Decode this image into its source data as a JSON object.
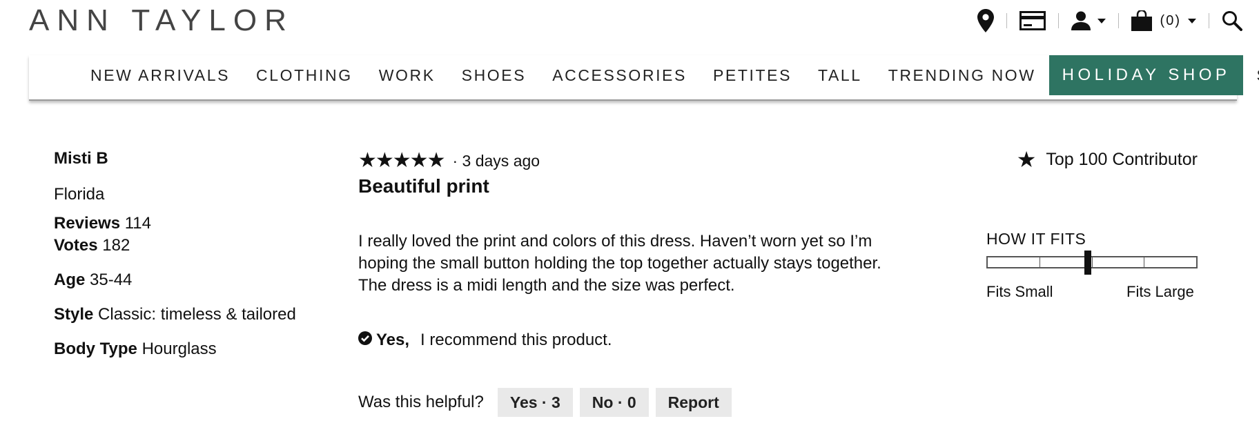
{
  "brand": {
    "logo": "ANN TAYLOR"
  },
  "utility": {
    "icons": [
      "location-pin-icon",
      "credit-card-icon",
      "account-icon",
      "shopping-bag-icon",
      "search-icon"
    ],
    "bag_count": "(0)"
  },
  "nav": {
    "items": [
      {
        "label": "NEW ARRIVALS"
      },
      {
        "label": "CLOTHING"
      },
      {
        "label": "WORK"
      },
      {
        "label": "SHOES"
      },
      {
        "label": "ACCESSORIES"
      },
      {
        "label": "PETITES"
      },
      {
        "label": "TALL"
      },
      {
        "label": "TRENDING NOW"
      },
      {
        "label": "HOLIDAY SHOP",
        "highlight": true
      },
      {
        "label": "SALE"
      }
    ],
    "highlight_color": "#2e7462"
  },
  "reviewer": {
    "name": "Misti B",
    "location": "Florida",
    "reviews_label": "Reviews",
    "reviews_value": "114",
    "votes_label": "Votes",
    "votes_value": "182",
    "age_label": "Age",
    "age_value": "35-44",
    "style_label": "Style",
    "style_value": "Classic: timeless & tailored",
    "body_label": "Body Type",
    "body_value": "Hourglass"
  },
  "review": {
    "rating": 5,
    "stars": "★★★★★",
    "date": "· 3 days ago",
    "title": "Beautiful print",
    "body_lines": [
      "I really loved the print and colors of this dress. Haven’t worn yet so I’m",
      "hoping the small button holding the top together actually stays together.",
      "The dress is a midi length and the size was perfect."
    ],
    "recommend_yes": "Yes,",
    "recommend_text": "I recommend this product."
  },
  "helpful": {
    "label": "Was this helpful?",
    "yes": "Yes · 3",
    "no": "No · 0",
    "report": "Report"
  },
  "badge": {
    "label": "Top 100 Contributor"
  },
  "fit": {
    "title": "HOW IT FITS",
    "min_label": "Fits Small",
    "max_label": "Fits Large",
    "value": 0.48
  }
}
